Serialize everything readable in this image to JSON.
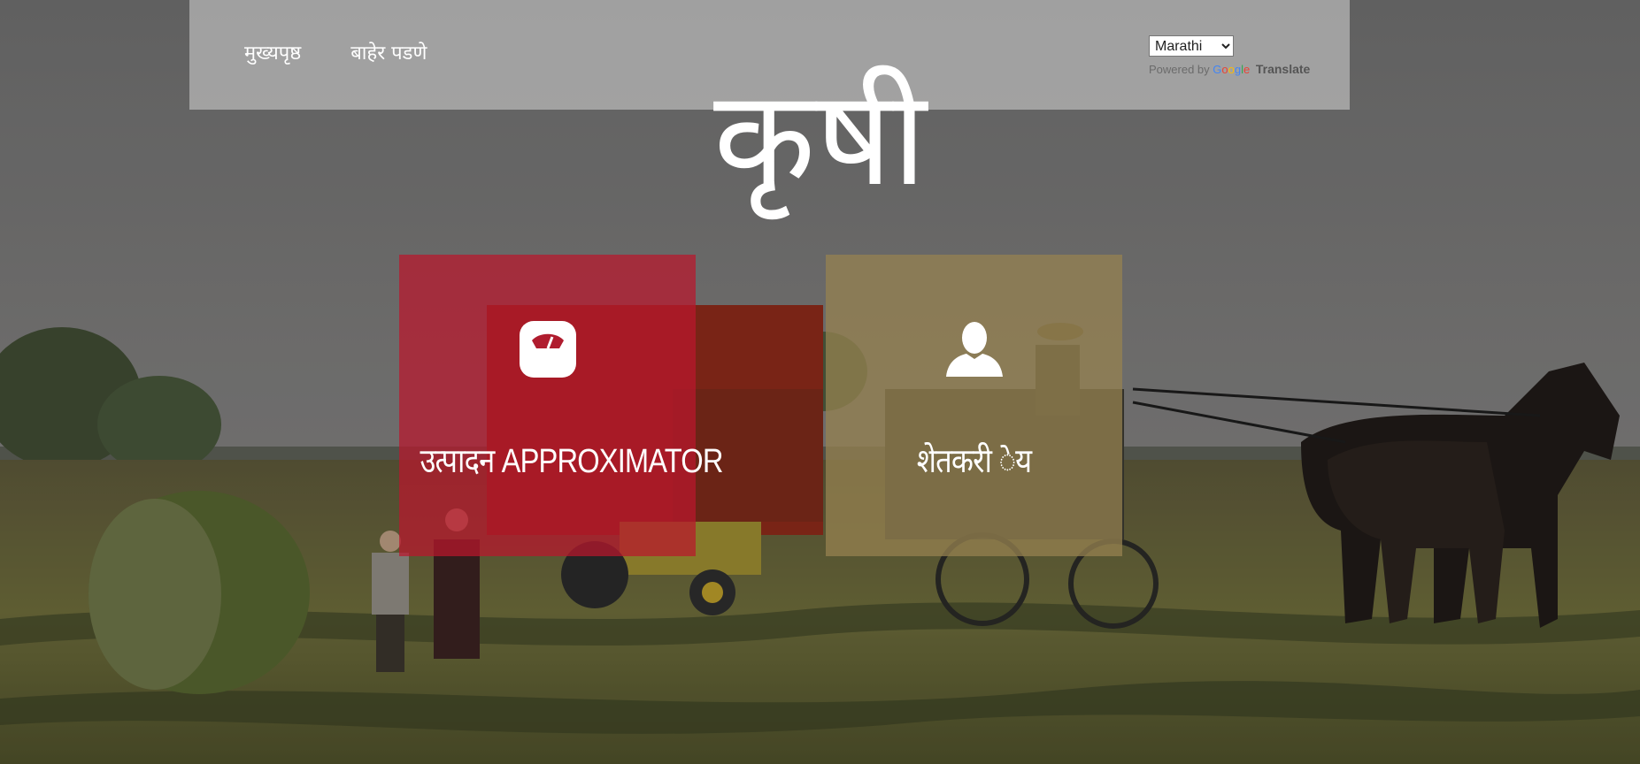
{
  "nav": {
    "items": [
      {
        "label": "मुख्यपृष्ठ"
      },
      {
        "label": "बाहेर पडणे"
      }
    ]
  },
  "translate": {
    "selected_language": "Marathi",
    "powered_by": "Powered by",
    "translate_label": "Translate"
  },
  "brand": {
    "title": "कृषी"
  },
  "tiles": [
    {
      "label": "उत्पादन APPROXIMATOR",
      "icon": "scale-icon",
      "color": "#ba162c"
    },
    {
      "label": "शेतकरी ेय",
      "icon": "user-icon",
      "color": "#968250"
    }
  ],
  "theme": {
    "navbar_bg": "#c8c8c8",
    "text_color": "#ffffff"
  }
}
